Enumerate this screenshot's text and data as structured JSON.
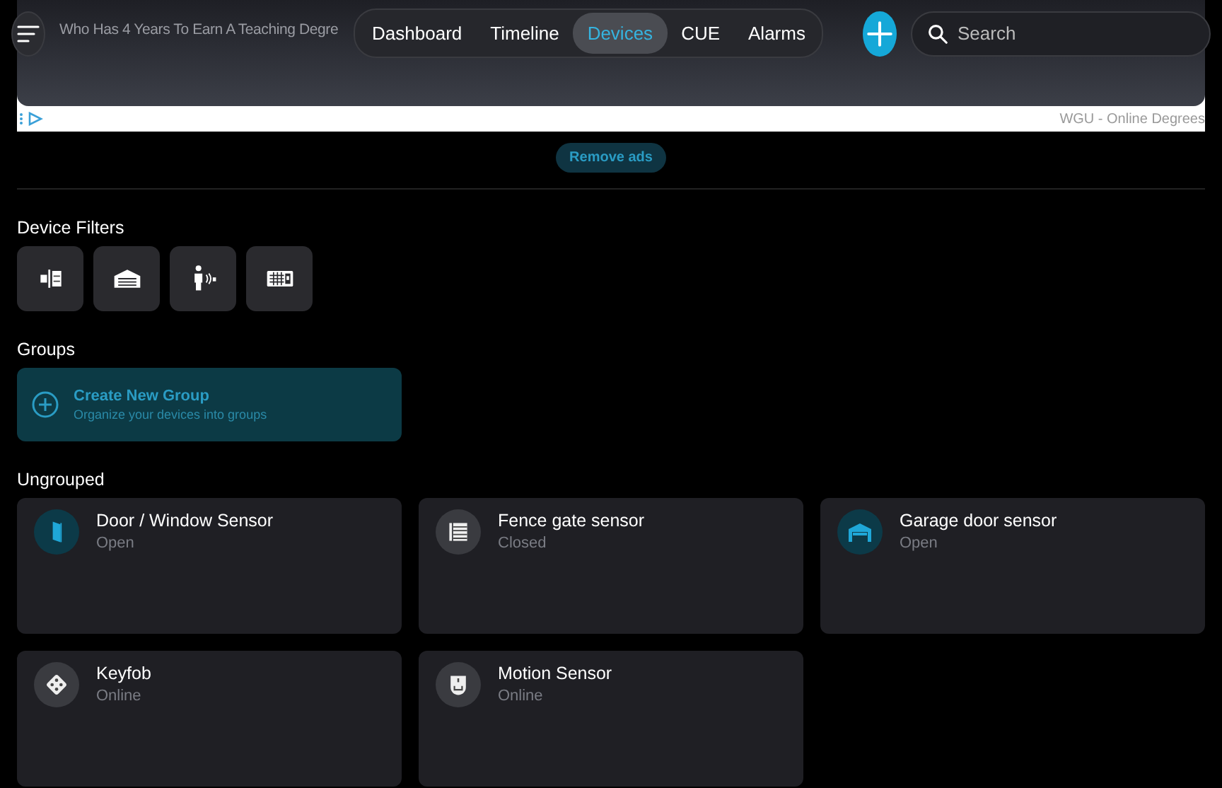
{
  "ad": {
    "headline": "Who Has 4 Years To Earn A Teaching Degre",
    "sponsor": "WGU - Online Degrees"
  },
  "nav": {
    "tabs": [
      {
        "label": "Dashboard",
        "selected": false
      },
      {
        "label": "Timeline",
        "selected": false
      },
      {
        "label": "Devices",
        "selected": true
      },
      {
        "label": "CUE",
        "selected": false
      },
      {
        "label": "Alarms",
        "selected": false
      }
    ],
    "search": {
      "placeholder": "Search"
    }
  },
  "remove_ads": "Remove ads",
  "filters": {
    "title": "Device Filters",
    "items": [
      {
        "kind": "contact"
      },
      {
        "kind": "garage"
      },
      {
        "kind": "motion"
      },
      {
        "kind": "keypad"
      }
    ]
  },
  "groups": {
    "title": "Groups",
    "create": {
      "title": "Create New Group",
      "subtitle": "Organize your devices into groups"
    }
  },
  "ungrouped": {
    "title": "Ungrouped",
    "devices": [
      {
        "kind": "door",
        "name": "Door / Window Sensor",
        "status": "Open",
        "active": true
      },
      {
        "kind": "gate",
        "name": "Fence gate sensor",
        "status": "Closed",
        "active": false
      },
      {
        "kind": "garage",
        "name": "Garage door sensor",
        "status": "Open",
        "active": true
      },
      {
        "kind": "keyfob",
        "name": "Keyfob",
        "status": "Online",
        "active": false
      },
      {
        "kind": "motion",
        "name": "Motion Sensor",
        "status": "Online",
        "active": false
      }
    ]
  }
}
